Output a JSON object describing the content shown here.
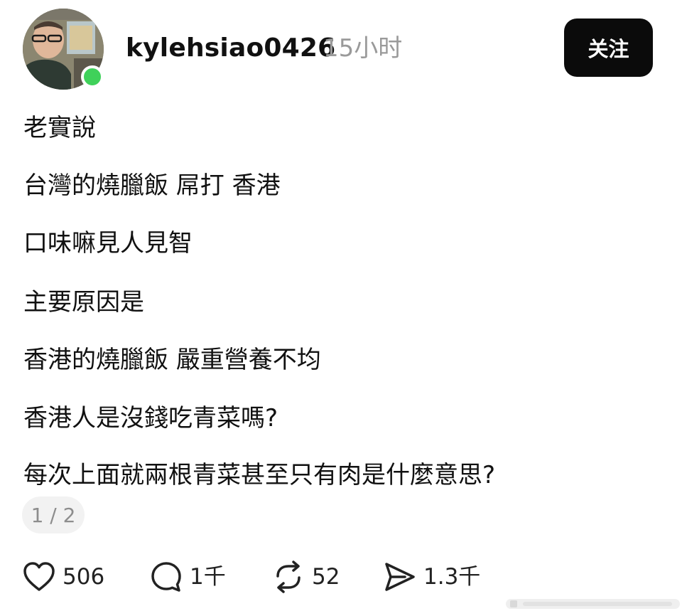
{
  "post": {
    "author": "kylehsiao0426",
    "time": "15小时",
    "follow_label": "关注",
    "lines": [
      "老實說",
      "台灣的燒臘飯 屌打 香港",
      "口味嘛見人見智",
      "主要原因是",
      "香港的燒臘飯 嚴重營養不均",
      "香港人是沒錢吃青菜嗎?",
      "每次上面就兩根青菜甚至只有肉是什麼意思?"
    ],
    "page_indicator": "1 / 2"
  },
  "actions": {
    "like": {
      "icon": "heart-icon",
      "count": "506"
    },
    "comment": {
      "icon": "comment-bubble-icon",
      "count": "1千"
    },
    "repost": {
      "icon": "repost-icon",
      "count": "52"
    },
    "share": {
      "icon": "send-icon",
      "count": "1.3千"
    }
  },
  "colors": {
    "online": "#3fd15a",
    "follow_bg": "#0b0b0b",
    "muted_text": "#9a9a9a"
  }
}
